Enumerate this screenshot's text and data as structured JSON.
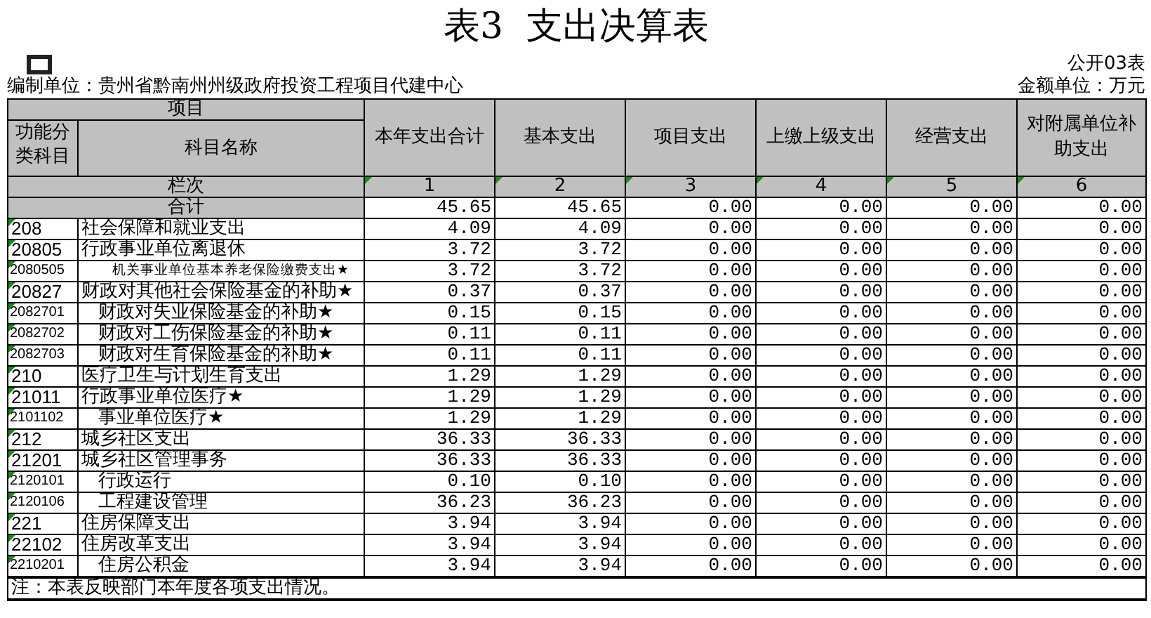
{
  "title": "表3  支出决算表",
  "form_no": "公开03表",
  "unit": "编制单位：贵州省黔南州州级政府投资工程项目代建中心",
  "currency": "金额单位：万元",
  "header": {
    "group": "项目",
    "code": "功能分类科目",
    "name": "科目名称",
    "columns": [
      "本年支出合计",
      "基本支出",
      "项目支出",
      "上缴上级支出",
      "经营支出",
      "对附属单位补助支出"
    ]
  },
  "index_row": {
    "label": "栏次",
    "numbers": [
      "1",
      "2",
      "3",
      "4",
      "5",
      "6"
    ]
  },
  "total_row": {
    "label": "合计",
    "values": [
      "45.65",
      "45.65",
      "0.00",
      "0.00",
      "0.00",
      "0.00"
    ]
  },
  "rows": [
    {
      "code": "208",
      "name": "社会保障和就业支出",
      "values": [
        "4.09",
        "4.09",
        "0.00",
        "0.00",
        "0.00",
        "0.00"
      ],
      "children": [
        {
          "code": "20805",
          "name": "行政事业单位离退休",
          "values": [
            "3.72",
            "3.72",
            "0.00",
            "0.00",
            "0.00",
            "0.00"
          ],
          "children": [
            {
              "code": "2080505",
              "name": "机关事业单位基本养老保险缴费支出★",
              "compact": true,
              "values": [
                "3.72",
                "3.72",
                "0.00",
                "0.00",
                "0.00",
                "0.00"
              ]
            }
          ]
        },
        {
          "code": "20827",
          "name": "财政对其他社会保险基金的补助★",
          "values": [
            "0.37",
            "0.37",
            "0.00",
            "0.00",
            "0.00",
            "0.00"
          ],
          "children": [
            {
              "code": "2082701",
              "name": "财政对失业保险基金的补助★",
              "values": [
                "0.15",
                "0.15",
                "0.00",
                "0.00",
                "0.00",
                "0.00"
              ]
            },
            {
              "code": "2082702",
              "name": "财政对工伤保险基金的补助★",
              "values": [
                "0.11",
                "0.11",
                "0.00",
                "0.00",
                "0.00",
                "0.00"
              ]
            },
            {
              "code": "2082703",
              "name": "财政对生育保险基金的补助★",
              "values": [
                "0.11",
                "0.11",
                "0.00",
                "0.00",
                "0.00",
                "0.00"
              ]
            }
          ]
        }
      ]
    },
    {
      "code": "210",
      "name": "医疗卫生与计划生育支出",
      "values": [
        "1.29",
        "1.29",
        "0.00",
        "0.00",
        "0.00",
        "0.00"
      ],
      "children": [
        {
          "code": "21011",
          "name": "行政事业单位医疗★",
          "values": [
            "1.29",
            "1.29",
            "0.00",
            "0.00",
            "0.00",
            "0.00"
          ],
          "children": [
            {
              "code": "2101102",
              "name": "事业单位医疗★",
              "values": [
                "1.29",
                "1.29",
                "0.00",
                "0.00",
                "0.00",
                "0.00"
              ]
            }
          ]
        }
      ]
    },
    {
      "code": "212",
      "name": "城乡社区支出",
      "values": [
        "36.33",
        "36.33",
        "0.00",
        "0.00",
        "0.00",
        "0.00"
      ],
      "children": [
        {
          "code": "21201",
          "name": "城乡社区管理事务",
          "values": [
            "36.33",
            "36.33",
            "0.00",
            "0.00",
            "0.00",
            "0.00"
          ],
          "children": [
            {
              "code": "2120101",
              "name": "行政运行",
              "values": [
                "0.10",
                "0.10",
                "0.00",
                "0.00",
                "0.00",
                "0.00"
              ]
            },
            {
              "code": "2120106",
              "name": "工程建设管理",
              "values": [
                "36.23",
                "36.23",
                "0.00",
                "0.00",
                "0.00",
                "0.00"
              ]
            }
          ]
        }
      ]
    },
    {
      "code": "221",
      "name": "住房保障支出",
      "values": [
        "3.94",
        "3.94",
        "0.00",
        "0.00",
        "0.00",
        "0.00"
      ],
      "children": [
        {
          "code": "22102",
          "name": "住房改革支出",
          "values": [
            "3.94",
            "3.94",
            "0.00",
            "0.00",
            "0.00",
            "0.00"
          ],
          "children": [
            {
              "code": "2210201",
              "name": "住房公积金",
              "values": [
                "3.94",
                "3.94",
                "0.00",
                "0.00",
                "0.00",
                "0.00"
              ]
            }
          ]
        }
      ]
    }
  ],
  "note": "注：本表反映部门本年度各项支出情况。"
}
